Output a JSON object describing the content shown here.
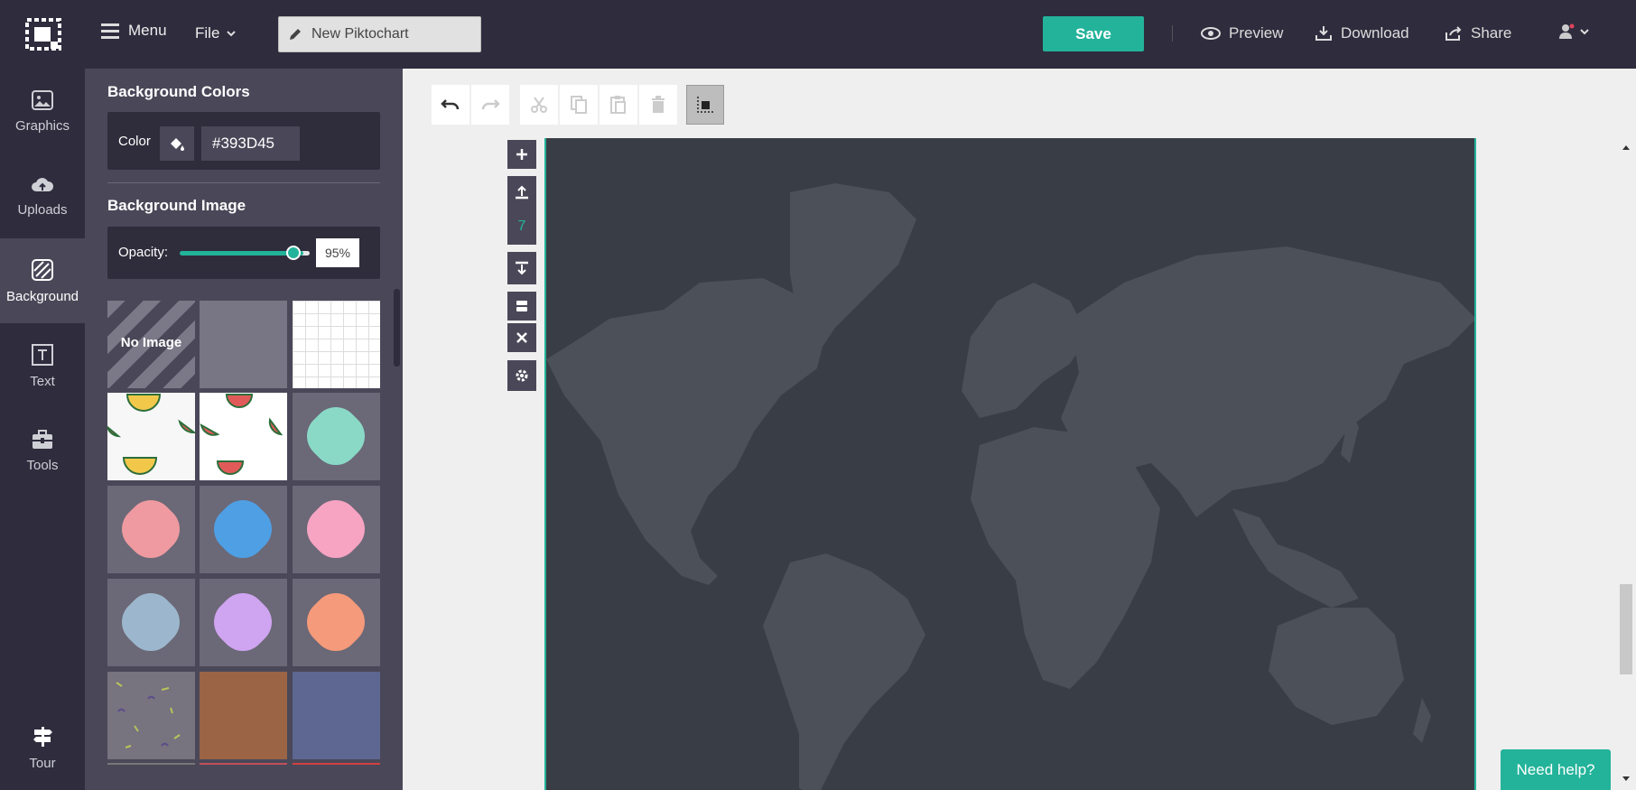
{
  "topbar": {
    "menu_label": "Menu",
    "file_label": "File",
    "title_value": "New Piktochart",
    "save_label": "Save",
    "preview_label": "Preview",
    "download_label": "Download",
    "share_label": "Share"
  },
  "leftnav": {
    "items": [
      {
        "label": "Graphics",
        "icon": "image-icon"
      },
      {
        "label": "Uploads",
        "icon": "cloud-upload-icon"
      },
      {
        "label": "Background",
        "icon": "hatch-icon"
      },
      {
        "label": "Text",
        "icon": "text-icon"
      },
      {
        "label": "Tools",
        "icon": "toolbox-icon"
      }
    ],
    "tour_label": "Tour"
  },
  "panel": {
    "bg_colors_title": "Background Colors",
    "color_label": "Color",
    "color_hex": "#393D45",
    "bg_image_title": "Background Image",
    "opacity_label": "Opacity:",
    "opacity_value": "95%",
    "opacity_level": 0.95,
    "no_image_label": "No Image"
  },
  "canvas": {
    "block_number": "7",
    "background": "#393d45",
    "accent": "#23b39a"
  },
  "help_label": "Need help?"
}
